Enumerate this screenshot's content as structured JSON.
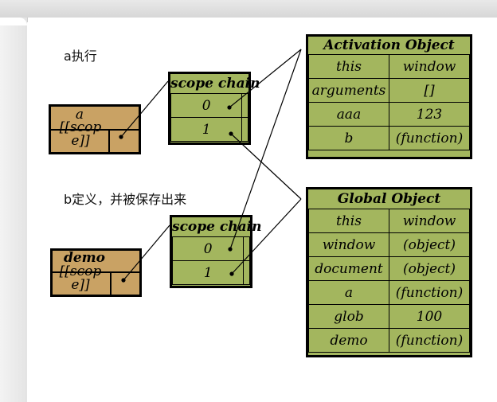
{
  "captions": {
    "a_exec": "a执行",
    "b_define": "b定义，并被保存出来"
  },
  "func_a": {
    "name": "a",
    "scope": "[[scope]]"
  },
  "func_demo": {
    "name": "demo",
    "scope": "[[scope]]"
  },
  "scope_chain_a": {
    "title": "scope chain",
    "rows": [
      "0",
      "1"
    ]
  },
  "scope_chain_demo": {
    "title": "scope chain",
    "rows": [
      "0",
      "1"
    ]
  },
  "activation_object": {
    "title": "Activation Object",
    "rows": [
      {
        "key": "this",
        "value": "window"
      },
      {
        "key": "arguments",
        "value": "[]"
      },
      {
        "key": "aaa",
        "value": "123"
      },
      {
        "key": "b",
        "value": "(function)"
      }
    ]
  },
  "global_object": {
    "title": "Global Object",
    "rows": [
      {
        "key": "this",
        "value": "window"
      },
      {
        "key": "window",
        "value": "(object)"
      },
      {
        "key": "document",
        "value": "(object)"
      },
      {
        "key": "a",
        "value": "(function)"
      },
      {
        "key": "glob",
        "value": "100"
      },
      {
        "key": "demo",
        "value": "(function)"
      }
    ]
  },
  "colors": {
    "cell_green": "#a3b65e",
    "func_brown": "#c9a264"
  }
}
